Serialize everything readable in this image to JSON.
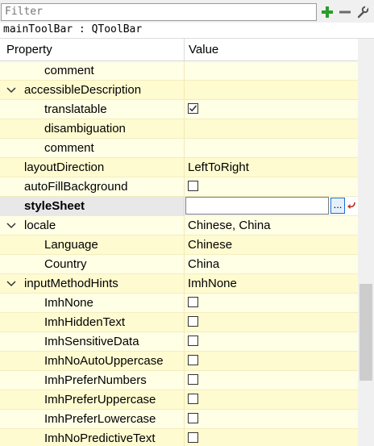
{
  "filter": {
    "placeholder": "Filter"
  },
  "object_label": "mainToolBar : QToolBar",
  "header": {
    "property": "Property",
    "value": "Value"
  },
  "colors": {
    "row": "#ffffe6",
    "row_alt": "#fffbd0",
    "add_green": "#2a9d2a"
  },
  "icons": {
    "add": "plus-icon",
    "remove": "minus-icon",
    "configure": "wrench-icon"
  },
  "rows": [
    {
      "name": "comment",
      "value": ""
    },
    {
      "name": "accessibleDescription",
      "value": ""
    },
    {
      "name": "translatable",
      "value": "",
      "checked": true
    },
    {
      "name": "disambiguation",
      "value": ""
    },
    {
      "name": "comment",
      "value": ""
    },
    {
      "name": "layoutDirection",
      "value": "LeftToRight"
    },
    {
      "name": "autoFillBackground",
      "value": "",
      "checked": false
    },
    {
      "name": "styleSheet",
      "value": "",
      "edit_button": "..."
    },
    {
      "name": "locale",
      "value": "Chinese, China"
    },
    {
      "name": "Language",
      "value": "Chinese"
    },
    {
      "name": "Country",
      "value": "China"
    },
    {
      "name": "inputMethodHints",
      "value": "ImhNone"
    },
    {
      "name": "ImhNone",
      "value": "",
      "checked": false
    },
    {
      "name": "ImhHiddenText",
      "value": "",
      "checked": false
    },
    {
      "name": "ImhSensitiveData",
      "value": "",
      "checked": false
    },
    {
      "name": "ImhNoAutoUppercase",
      "value": "",
      "checked": false
    },
    {
      "name": "ImhPreferNumbers",
      "value": "",
      "checked": false
    },
    {
      "name": "ImhPreferUppercase",
      "value": "",
      "checked": false
    },
    {
      "name": "ImhPreferLowercase",
      "value": "",
      "checked": false
    },
    {
      "name": "ImhNoPredictiveText",
      "value": "",
      "checked": false
    }
  ]
}
